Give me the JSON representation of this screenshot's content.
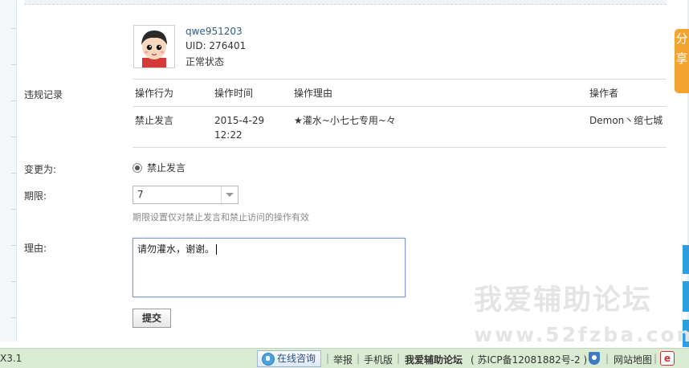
{
  "user": {
    "username": "qwe951203",
    "uid": "UID: 276401",
    "status": "正常状态"
  },
  "violations": {
    "label": "违规记录",
    "headers": [
      "操作行为",
      "操作时间",
      "操作理由",
      "操作者"
    ],
    "rows": [
      {
        "action": "禁止发言",
        "date": "2015-4-29",
        "time": "12:22",
        "reason": "★灌水~小七七专用~々",
        "operator": "Demon丶绾七城"
      }
    ]
  },
  "change": {
    "label": "变更为:",
    "option": "禁止发言"
  },
  "period": {
    "label": "期限:",
    "value": "7",
    "hint": "期限设置仅对禁止发言和禁止访问的操作有效"
  },
  "reason": {
    "label": "理由:",
    "value": "请勿灌水，谢谢。"
  },
  "submit_label": "提交",
  "share_tab": "分享",
  "watermark": {
    "line1": "我爱辅助论坛",
    "line2": "www.52fzba.com"
  },
  "footer": {
    "version": "X3.1",
    "online": "在线咨询",
    "report": "举报",
    "mobile": "手机版",
    "site_name": "我爱辅助论坛",
    "icp": "( 苏ICP备12081882号-2 )",
    "sitemap": "网站地图",
    "elogo": "e"
  },
  "colors": {
    "link": "#335b87",
    "footer_bg": "#d9ebd2",
    "share_tab": "#f3a430",
    "side_blue": "#2e9ee3",
    "textarea_border": "#7d9bd4"
  }
}
